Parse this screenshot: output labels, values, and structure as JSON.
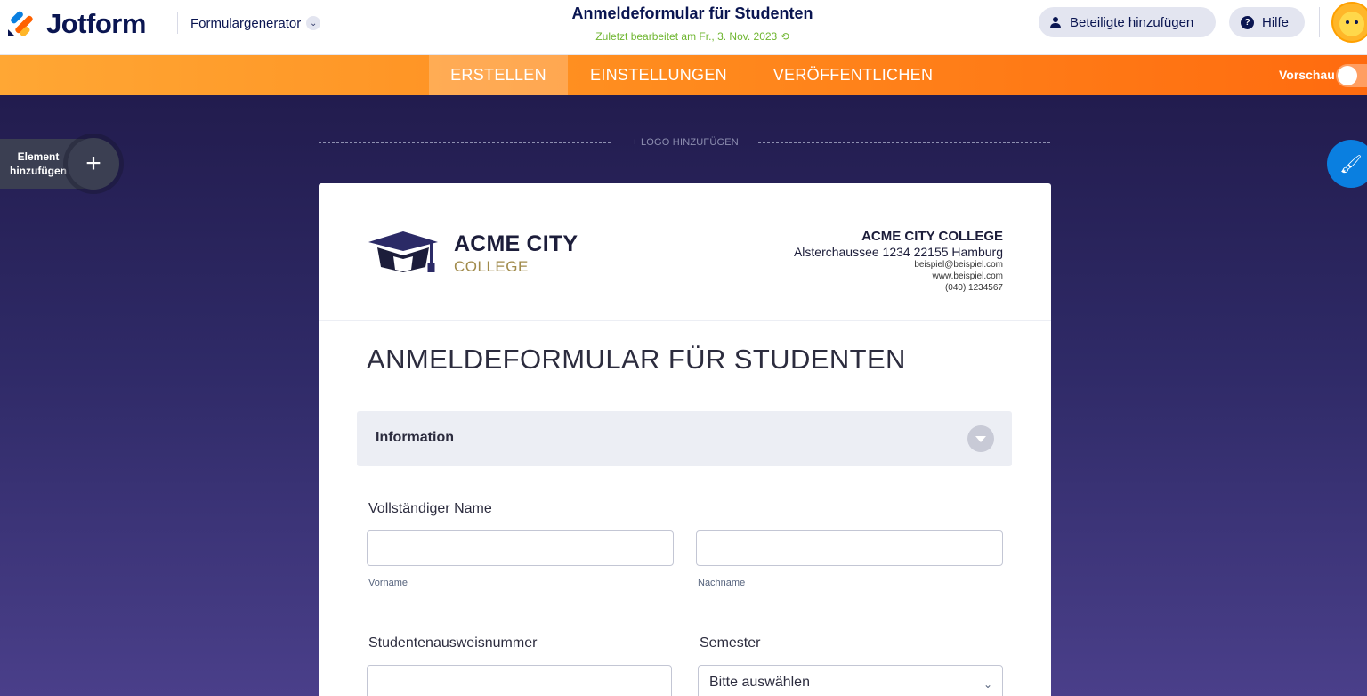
{
  "header": {
    "brand": "Jotform",
    "builder_label": "Formulargenerator",
    "form_title": "Anmeldeformular für Studenten",
    "last_edited": "Zuletzt bearbeitet am Fr., 3. Nov. 2023",
    "share_label": "Beteiligte hinzufügen",
    "help_label": "Hilfe"
  },
  "nav": {
    "tabs": [
      {
        "label": "ERSTELLEN",
        "active": true
      },
      {
        "label": "EINSTELLUNGEN",
        "active": false
      },
      {
        "label": "VERÖFFENTLICHEN",
        "active": false
      }
    ],
    "preview_label": "Vorschau",
    "preview_on": false
  },
  "canvas": {
    "add_element_label": "Element hinzufügen",
    "add_logo_label": "+ LOGO HINZUFÜGEN"
  },
  "form": {
    "header": {
      "college_name": "ACME CITY",
      "college_sub": "COLLEGE",
      "org_name": "ACME CITY COLLEGE",
      "address": "Alsterchaussee 1234 22155 Hamburg",
      "email": "beispiel@beispiel.com",
      "website": "www.beispiel.com",
      "phone": "(040) 1234567"
    },
    "title": "ANMELDEFORMULAR FÜR STUDENTEN",
    "section_label": "Information",
    "full_name_label": "Vollständiger Name",
    "first_name_sublabel": "Vorname",
    "last_name_sublabel": "Nachname",
    "student_id_label": "Studentenausweisnummer",
    "semester_label": "Semester",
    "semester_value": "Bitte auswählen"
  },
  "colors": {
    "brand_navy": "#0a1551",
    "nav_orange": "#ff8d1f",
    "canvas_purple": "#2a2560",
    "edited_green": "#6eb52f",
    "accent_blue": "#0a7fe0"
  }
}
